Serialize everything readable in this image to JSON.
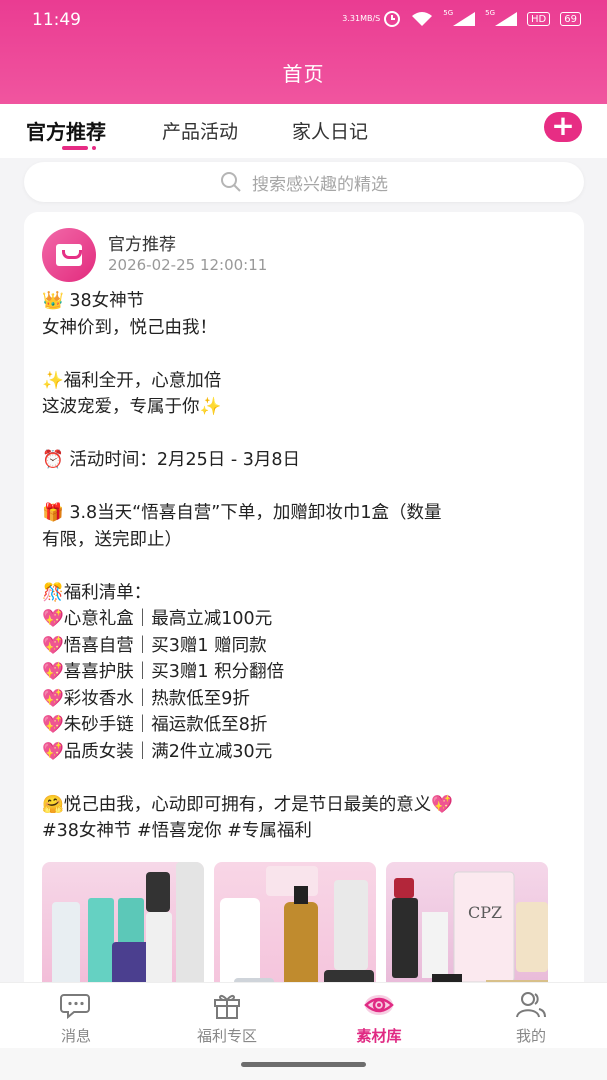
{
  "status_bar": {
    "time": "11:49",
    "net_speed_value": "3.31",
    "net_speed_unit": "MB/S",
    "sig1": "5G",
    "sig2": "5G",
    "hd": "HD",
    "battery": "69"
  },
  "header": {
    "title": "首页"
  },
  "tabs": [
    {
      "label": "官方推荐",
      "active": true
    },
    {
      "label": "产品活动",
      "active": false
    },
    {
      "label": "家人日记",
      "active": false
    }
  ],
  "add_button": {
    "label": "+"
  },
  "search": {
    "placeholder": "搜索感兴趣的精选"
  },
  "post": {
    "author": "官方推荐",
    "date": "2026-02-25 12:00:11",
    "lines": [
      "  👑 38女神节",
      "女神价到，悦己由我！",
      "",
      "✨福利全开，心意加倍",
      "这波宠爱，专属于你✨",
      "",
      "⏰ 活动时间：2月25日 - 3月8日",
      "",
      "🎁 3.8当天“悟喜自营”下单，加赠卸妆巾1盒（数量",
      "有限，送完即止）",
      "",
      "🎊福利清单：",
      "💖心意礼盒｜最高立减100元",
      "💖悟喜自营｜买3赠1 赠同款",
      "💖喜喜护肤｜买3赠1 积分翻倍",
      "💖彩妆香水｜热款低至9折",
      "💖朱砂手链｜福运款低至8折",
      "💖品质女装｜满2件立减30元",
      "",
      "🤗悦己由我，心动即可拥有，才是节日最美的意义💖",
      "#38女神节 #悟喜宠你 #专属福利"
    ]
  },
  "thumbnails": {
    "thumb3_label": "CPZ"
  },
  "bottom_nav": [
    {
      "label": "消息",
      "icon": "chat-icon",
      "active": false
    },
    {
      "label": "福利专区",
      "icon": "gift-icon",
      "active": false
    },
    {
      "label": "素材库",
      "icon": "eye-icon",
      "active": true
    },
    {
      "label": "我的",
      "icon": "user-icon",
      "active": false
    }
  ],
  "colors": {
    "brand": "#e62b84",
    "header": "#ea3c92",
    "inactive": "#888888"
  }
}
